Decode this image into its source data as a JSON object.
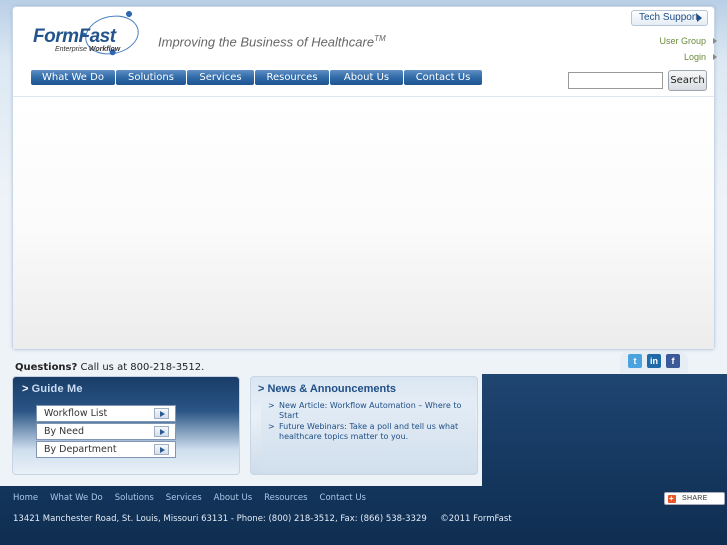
{
  "header": {
    "logo_main_a": "Form",
    "logo_main_b": "Fast",
    "logo_sub_a": "Enterprise",
    "logo_sub_b": "Workflow",
    "tagline": "Improving the Business of Healthcare",
    "tagline_tm": "TM",
    "tech_support": "Tech Support",
    "user_group": "User Group",
    "login": "Login"
  },
  "nav": {
    "items": [
      "What We Do",
      "Solutions",
      "Services",
      "Resources",
      "About Us",
      "Contact Us"
    ]
  },
  "search": {
    "value": "",
    "button_label": "Search"
  },
  "questions": {
    "label": "Questions?",
    "text": "Call us at 800-218-3512."
  },
  "social": {
    "items": [
      "twitter-icon",
      "linkedin-icon",
      "facebook-icon"
    ],
    "twitter_glyph": "t",
    "linkedin_glyph": "in",
    "facebook_glyph": "f"
  },
  "guide": {
    "title": "Guide Me",
    "items": [
      "Workflow List",
      "By Need",
      "By Department"
    ]
  },
  "news": {
    "title": "News & Announcements",
    "items": [
      "New Article: Workflow Automation – Where to Start",
      "Future Webinars: Take a poll and tell us what healthcare topics matter to you."
    ]
  },
  "footer": {
    "nav": [
      "Home",
      "What We Do",
      "Solutions",
      "Services",
      "About Us",
      "Resources",
      "Contact Us"
    ],
    "address": "13421 Manchester Road, St. Louis, Missouri 63131 - Phone: (800) 218-3512, Fax: (866) 538-3329     ©2011 FormFast",
    "share_label": "SHARE"
  },
  "colors": {
    "brand_blue": "#23548c",
    "nav_blue": "#2f6aa7",
    "footer_bg": "#163a63"
  }
}
